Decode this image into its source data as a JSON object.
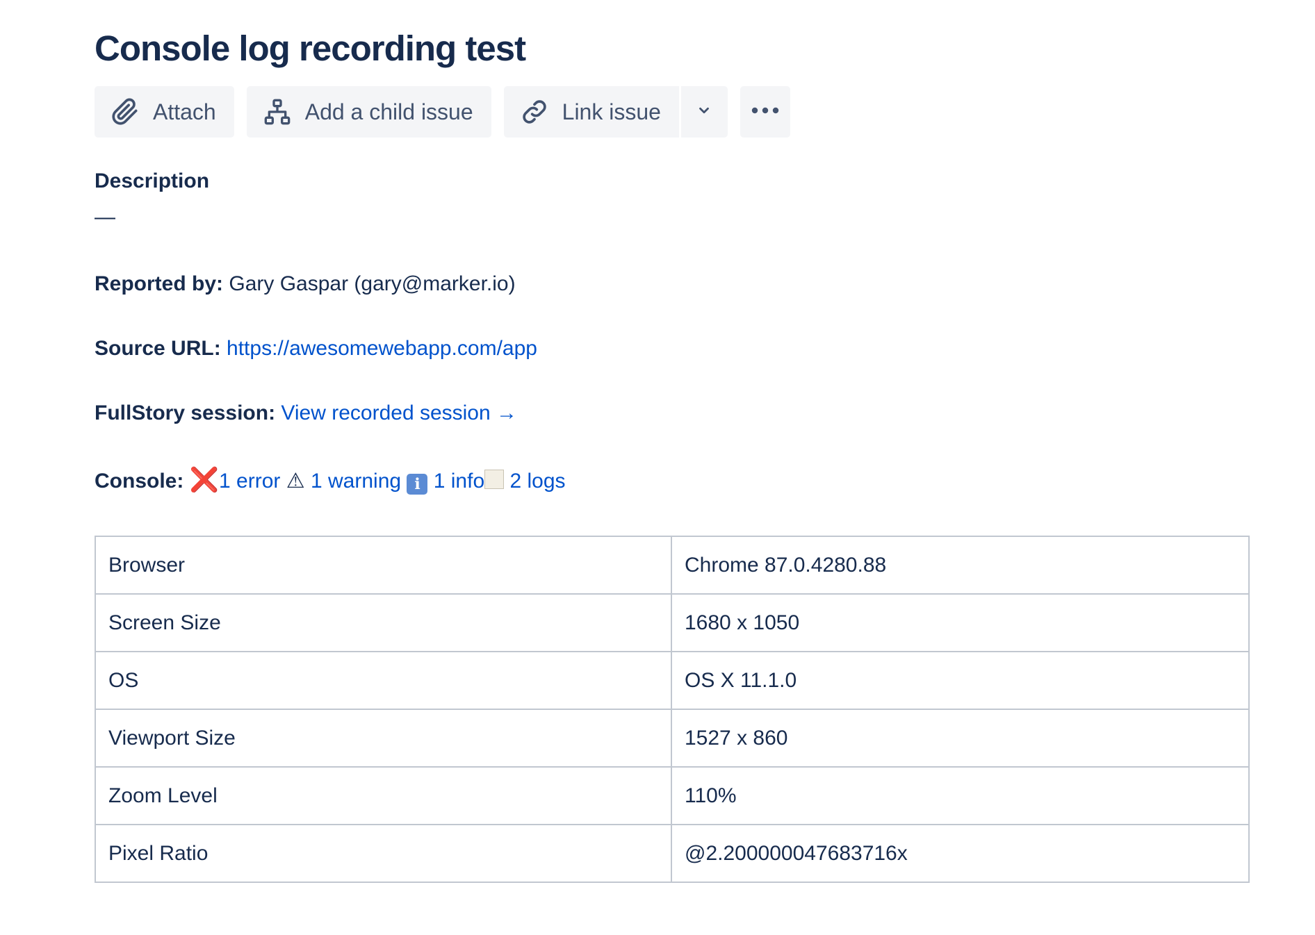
{
  "issue": {
    "title": "Console log recording test"
  },
  "toolbar": {
    "attach_label": "Attach",
    "add_child_label": "Add a child issue",
    "link_issue_label": "Link issue",
    "attach_icon": "paperclip-icon",
    "add_child_icon": "hierarchy-icon",
    "link_icon": "link-icon",
    "dropdown_icon": "chevron-down-icon",
    "more_icon": "more-horizontal-icon"
  },
  "description": {
    "heading": "Description",
    "empty_dash": "—",
    "reported_by_label": "Reported by:",
    "reported_by_value": "Gary Gaspar (gary@marker.io)",
    "source_url_label": "Source URL:",
    "source_url_value": "https://awesomewebapp.com/app",
    "fullstory_label": "FullStory session:",
    "fullstory_link": "View recorded session →",
    "console_label": "Console:",
    "console": {
      "error_icon": "❌",
      "error_text": "1 error",
      "warning_icon": "⚠",
      "warning_text": "1 warning",
      "info_icon": "ℹ",
      "info_text": "1 info",
      "log_icon": "scroll-icon",
      "log_text": "2 logs"
    }
  },
  "environment": {
    "rows": [
      {
        "key": "Browser",
        "value": "Chrome 87.0.4280.88"
      },
      {
        "key": "Screen Size",
        "value": "1680 x 1050"
      },
      {
        "key": "OS",
        "value": "OS X 11.1.0"
      },
      {
        "key": "Viewport Size",
        "value": "1527 x 860"
      },
      {
        "key": "Zoom Level",
        "value": "110%"
      },
      {
        "key": "Pixel Ratio",
        "value": "@2.200000047683716x"
      }
    ]
  },
  "colors": {
    "text": "#172b4d",
    "link": "#0052cc",
    "button_bg": "#f4f5f7",
    "button_text": "#42526e",
    "table_border": "#c1c7d0",
    "error_red": "#dd2e44"
  }
}
